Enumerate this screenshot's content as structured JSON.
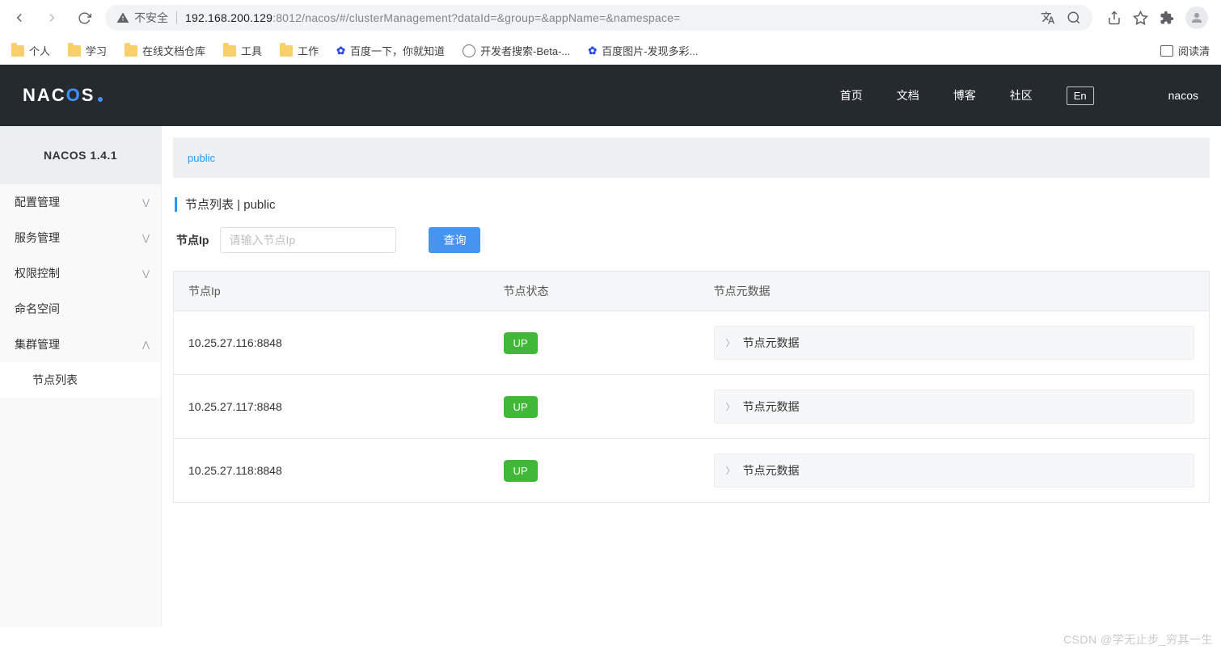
{
  "browser": {
    "security_label": "不安全",
    "url_host": "192.168.200.129",
    "url_port": ":8012",
    "url_path": "/nacos/#/clusterManagement?dataId=&group=&appName=&namespace="
  },
  "bookmarks": {
    "items": [
      "个人",
      "学习",
      "在线文档仓库",
      "工具",
      "工作"
    ],
    "links": [
      "百度一下，你就知道",
      "开发者搜索-Beta-...",
      "百度图片-发现多彩..."
    ],
    "right": "阅读清"
  },
  "header": {
    "nav": [
      "首页",
      "文档",
      "博客",
      "社区"
    ],
    "lang": "En",
    "user": "nacos"
  },
  "sidebar": {
    "title": "NACOS 1.4.1",
    "items": [
      {
        "label": "配置管理",
        "expandable": true
      },
      {
        "label": "服务管理",
        "expandable": true
      },
      {
        "label": "权限控制",
        "expandable": true
      },
      {
        "label": "命名空间",
        "expandable": false
      },
      {
        "label": "集群管理",
        "expandable": true,
        "open": true
      }
    ],
    "sub_item": "节点列表"
  },
  "content": {
    "namespace_tab": "public",
    "page_title": "节点列表",
    "page_title_sep": " | ",
    "page_title_ns": "public",
    "search": {
      "label": "节点Ip",
      "placeholder": "请输入节点Ip",
      "button": "查询"
    },
    "table": {
      "headers": [
        "节点Ip",
        "节点状态",
        "节点元数据"
      ],
      "rows": [
        {
          "ip": "10.25.27.116:8848",
          "status": "UP",
          "meta_label": "节点元数据"
        },
        {
          "ip": "10.25.27.117:8848",
          "status": "UP",
          "meta_label": "节点元数据"
        },
        {
          "ip": "10.25.27.118:8848",
          "status": "UP",
          "meta_label": "节点元数据"
        }
      ]
    }
  },
  "watermark": "CSDN @学无止步_穷其一生"
}
